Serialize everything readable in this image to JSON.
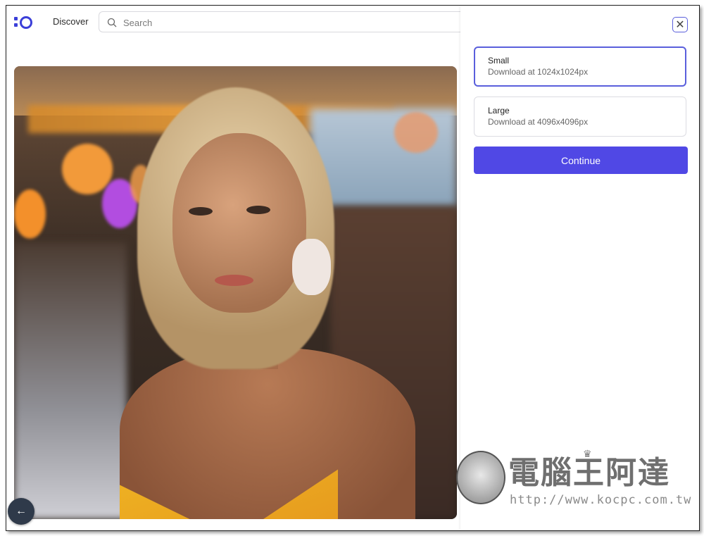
{
  "header": {
    "nav_discover": "Discover",
    "search_placeholder": "Search"
  },
  "download_panel": {
    "options": [
      {
        "title": "Small",
        "description": "Download at 1024x1024px",
        "selected": true
      },
      {
        "title": "Large",
        "description": "Download at 4096x4096px",
        "selected": false
      }
    ],
    "continue_label": "Continue",
    "accent_color": "#5048e5"
  },
  "watermark": {
    "name": "電腦王阿達",
    "url": "http://www.kocpc.com.tw"
  },
  "icons": [
    "logo-icon",
    "search-icon",
    "close-icon",
    "arrow-left-icon",
    "crown-icon"
  ]
}
